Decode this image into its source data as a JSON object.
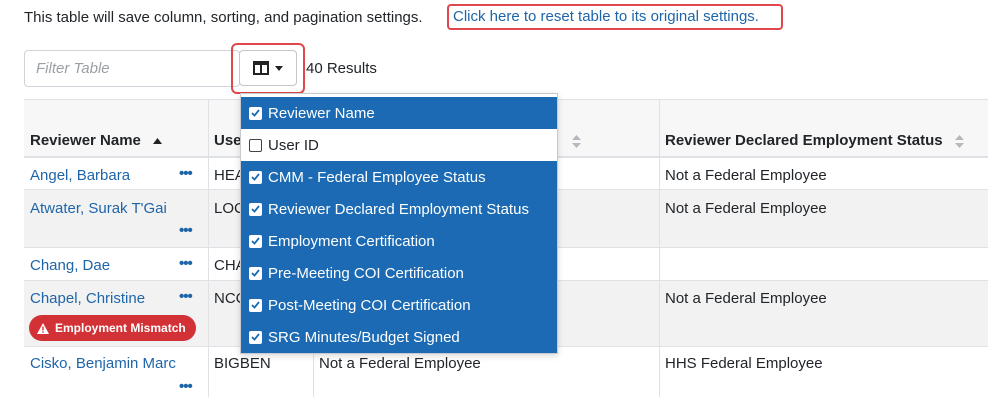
{
  "notice": {
    "text": "This table will save column, sorting, and pagination settings.",
    "reset_link": "Click here to reset table to its original settings."
  },
  "toolbar": {
    "filter_placeholder": "Filter Table",
    "columns_icon": "table-columns-icon",
    "results": "40 Results"
  },
  "table": {
    "headers": [
      "Reviewer Name",
      "Use",
      "",
      "Reviewer Declared Employment Status"
    ],
    "sort": {
      "column": "Reviewer Name",
      "direction": "ascending"
    },
    "rows": [
      {
        "name": "Angel, Barbara",
        "user_id": "HEA",
        "cmm": "",
        "declared": "Not a Federal Employee"
      },
      {
        "name": "Atwater, Surak T'Gai",
        "user_id": "LOC",
        "cmm": "",
        "declared": "Not a Federal Employee"
      },
      {
        "name": "Chang, Dae",
        "user_id": "CHA",
        "cmm": "",
        "declared": ""
      },
      {
        "name": "Chapel, Christine",
        "user_id": "NCC",
        "cmm": "",
        "declared": "Not a Federal Employee",
        "badge": "Employment Mismatch"
      },
      {
        "name": "Cisko, Benjamin Marc",
        "user_id": "BIGBEN",
        "cmm": "Not a Federal Employee",
        "declared": "HHS Federal Employee"
      }
    ],
    "more_label": "•••"
  },
  "column_menu": {
    "items": [
      {
        "label": "Reviewer Name",
        "checked": true
      },
      {
        "label": "User ID",
        "checked": false
      },
      {
        "label": "CMM - Federal Employee Status",
        "checked": true
      },
      {
        "label": "Reviewer Declared Employment Status",
        "checked": true
      },
      {
        "label": "Employment Certification",
        "checked": true
      },
      {
        "label": "Pre-Meeting COI Certification",
        "checked": true
      },
      {
        "label": "Post-Meeting COI Certification",
        "checked": true
      },
      {
        "label": "SRG Minutes/Budget Signed",
        "checked": true
      }
    ]
  },
  "colors": {
    "link": "#1e65a8",
    "menu_selected": "#1b6ab3",
    "highlight": "#e0474c",
    "badge": "#d23236"
  }
}
